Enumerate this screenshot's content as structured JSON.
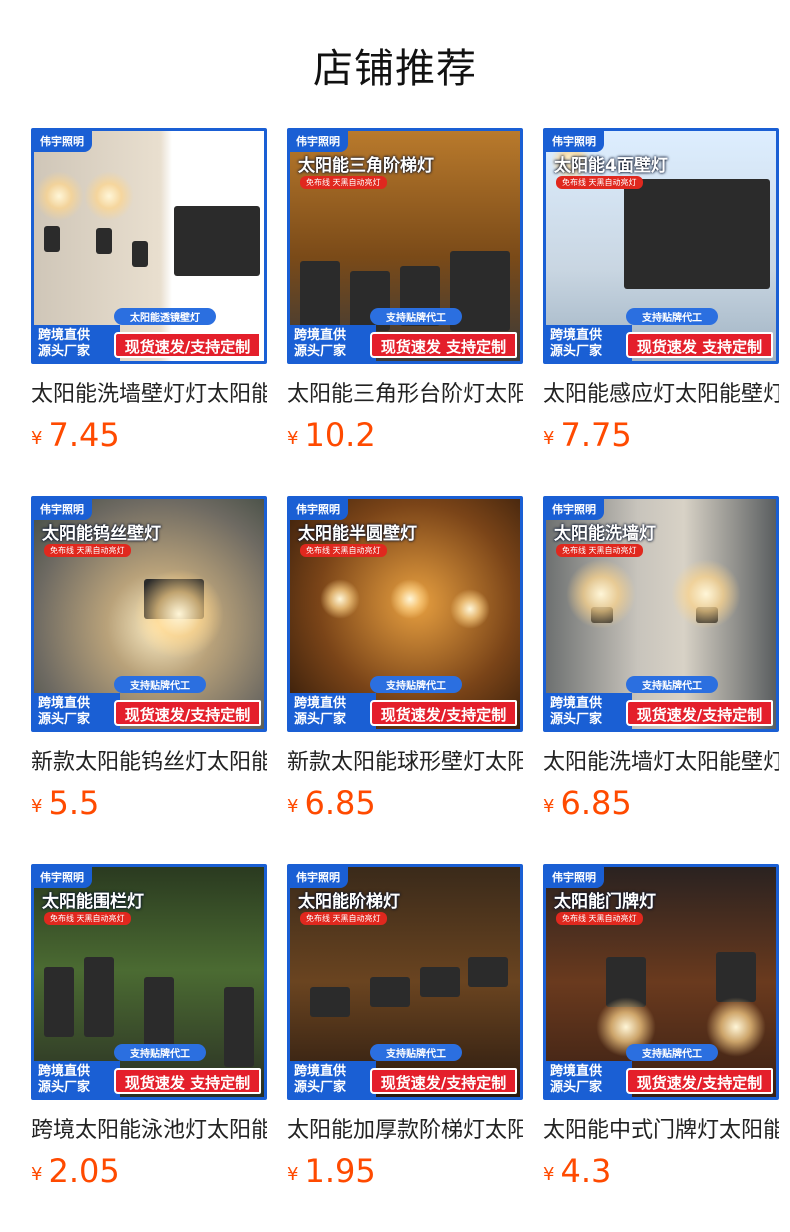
{
  "page": {
    "title": "店铺推荐"
  },
  "products": [
    {
      "brand": "伟宇照明",
      "overlay_title": "",
      "overlay_sub": "",
      "service_tag": "太阳能透镜壁灯",
      "badge_left_1": "跨境直供",
      "badge_left_2": "源头厂家",
      "badge_right": "现货速发/支持定制",
      "title": "太阳能洗墙壁灯灯太阳能",
      "currency": "¥",
      "price": "7.45"
    },
    {
      "brand": "伟宇照明",
      "overlay_title": "太阳能三角阶梯灯",
      "overlay_sub": "免布线 天黑自动亮灯",
      "service_tag": "支持贴牌代工",
      "badge_left_1": "跨境直供",
      "badge_left_2": "源头厂家",
      "badge_right": "现货速发 支持定制",
      "title": "太阳能三角形台阶灯太阳",
      "currency": "¥",
      "price": "10.2"
    },
    {
      "brand": "伟宇照明",
      "overlay_title": "太阳能4面壁灯",
      "overlay_sub": "免布线 天黑自动亮灯",
      "service_tag": "支持贴牌代工",
      "badge_left_1": "跨境直供",
      "badge_left_2": "源头厂家",
      "badge_right": "现货速发 支持定制",
      "title": "太阳能感应灯太阳能壁灯",
      "currency": "¥",
      "price": "7.75"
    },
    {
      "brand": "伟宇照明",
      "overlay_title": "太阳能钨丝壁灯",
      "overlay_sub": "免布线 天黑自动亮灯",
      "service_tag": "支持贴牌代工",
      "badge_left_1": "跨境直供",
      "badge_left_2": "源头厂家",
      "badge_right": "现货速发/支持定制",
      "title": "新款太阳能钨丝灯太阳能",
      "currency": "¥",
      "price": "5.5"
    },
    {
      "brand": "伟宇照明",
      "overlay_title": "太阳能半圆壁灯",
      "overlay_sub": "免布线 天黑自动亮灯",
      "service_tag": "支持贴牌代工",
      "badge_left_1": "跨境直供",
      "badge_left_2": "源头厂家",
      "badge_right": "现货速发/支持定制",
      "title": "新款太阳能球形壁灯太阳",
      "currency": "¥",
      "price": "6.85"
    },
    {
      "brand": "伟宇照明",
      "overlay_title": "太阳能洗墙灯",
      "overlay_sub": "免布线 天黑自动亮灯",
      "service_tag": "支持贴牌代工",
      "badge_left_1": "跨境直供",
      "badge_left_2": "源头厂家",
      "badge_right": "现货速发/支持定制",
      "title": "太阳能洗墙灯太阳能壁灯",
      "currency": "¥",
      "price": "6.85"
    },
    {
      "brand": "伟宇照明",
      "overlay_title": "太阳能围栏灯",
      "overlay_sub": "免布线 天黑自动亮灯",
      "service_tag": "支持贴牌代工",
      "badge_left_1": "跨境直供",
      "badge_left_2": "源头厂家",
      "badge_right": "现货速发 支持定制",
      "title": "跨境太阳能泳池灯太阳能",
      "currency": "¥",
      "price": "2.05"
    },
    {
      "brand": "伟宇照明",
      "overlay_title": "太阳能阶梯灯",
      "overlay_sub": "免布线 天黑自动亮灯",
      "service_tag": "支持贴牌代工",
      "badge_left_1": "跨境直供",
      "badge_left_2": "源头厂家",
      "badge_right": "现货速发/支持定制",
      "title": "太阳能加厚款阶梯灯太阳",
      "currency": "¥",
      "price": "1.95"
    },
    {
      "brand": "伟宇照明",
      "overlay_title": "太阳能门牌灯",
      "overlay_sub": "免布线 天黑自动亮灯",
      "service_tag": "支持贴牌代工",
      "badge_left_1": "跨境直供",
      "badge_left_2": "源头厂家",
      "badge_right": "现货速发/支持定制",
      "title": "太阳能中式门牌灯太阳能",
      "currency": "¥",
      "price": "4.3"
    }
  ]
}
